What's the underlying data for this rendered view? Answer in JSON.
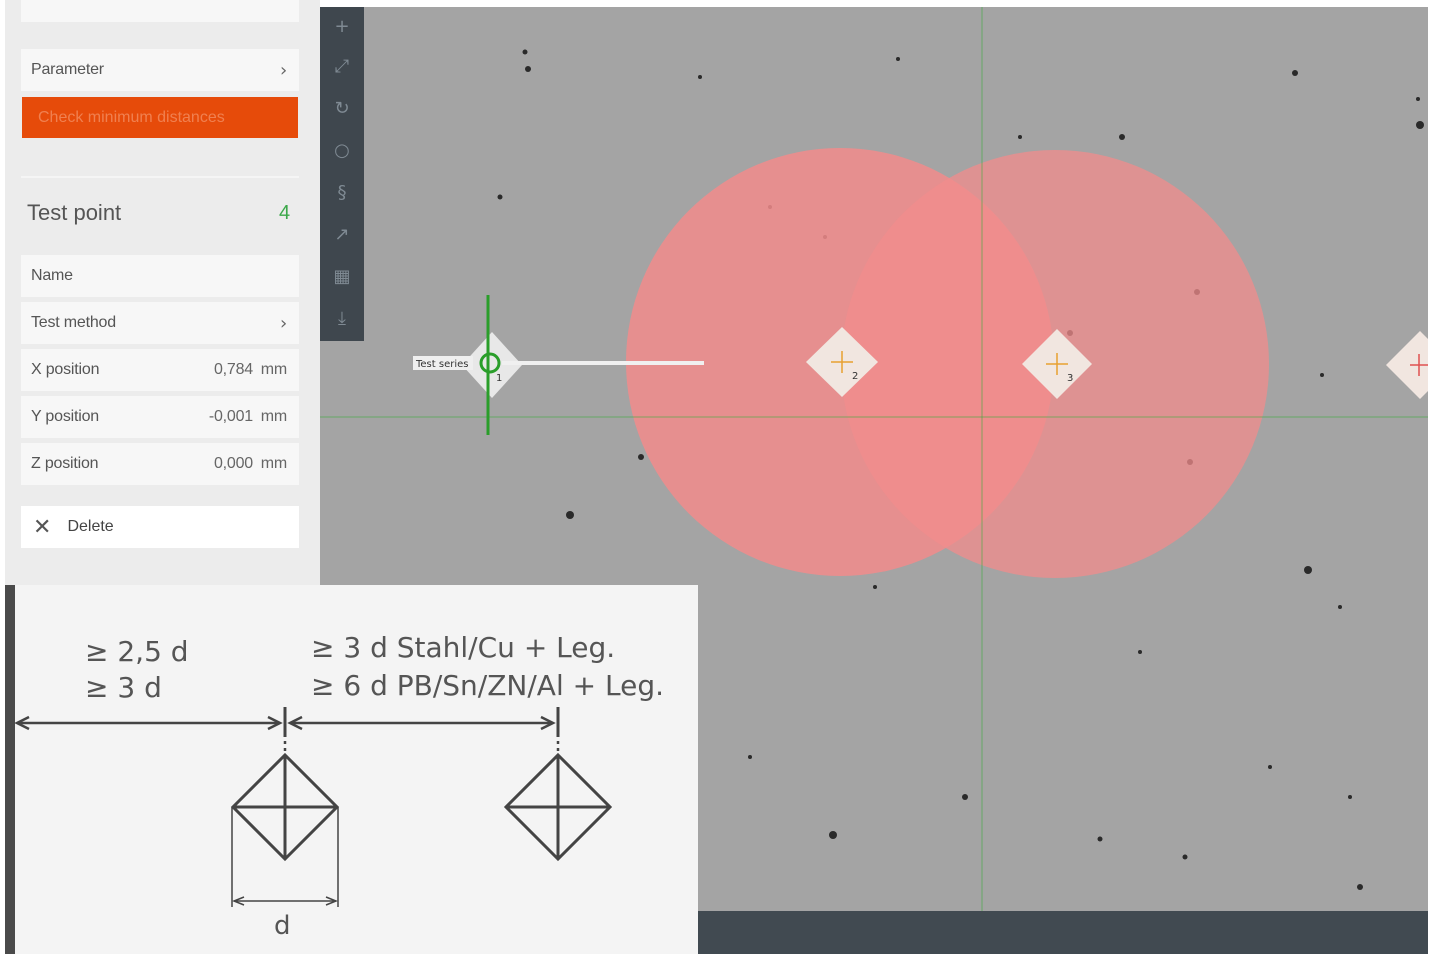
{
  "panel": {
    "parameter_label": "Parameter",
    "check_button_label": "Check minimum distances",
    "test_point_title": "Test point",
    "test_point_count": "4",
    "rows": {
      "name_label": "Name",
      "test_method_label": "Test method",
      "x_label": "X position",
      "x_value": "0,784",
      "x_unit": "mm",
      "y_label": "Y position",
      "y_value": "-0,001",
      "y_unit": "mm",
      "z_label": "Z position",
      "z_value": "0,000",
      "z_unit": "mm"
    },
    "delete_label": "Delete",
    "chevron": "›",
    "close_glyph": "✕"
  },
  "toolbar": {
    "icons": [
      "crosshair-add-icon",
      "move-arrows-icon",
      "rotate-icon",
      "circle-icon",
      "spiral-icon",
      "curve-arrow-icon",
      "grid-icon",
      "export-icon"
    ]
  },
  "view": {
    "series_label": "Test series",
    "point_labels": [
      "1",
      "2",
      "3"
    ],
    "colors": {
      "background": "#a4a4a4",
      "circle": "#f28c8c",
      "guide_line": "#3dac3d",
      "marker_cross": "#e8a030",
      "selected_marker": "#2a9e2a"
    }
  },
  "diagram": {
    "left_line1": "≥ 2,5 d",
    "left_line2": "≥ 3 d",
    "right_line1": "≥ 3 d Stahl/Cu + Leg.",
    "right_line2": "≥ 6 d PB/Sn/ZN/Al + Leg.",
    "d_label": "d"
  },
  "accent": "#e64b0a"
}
